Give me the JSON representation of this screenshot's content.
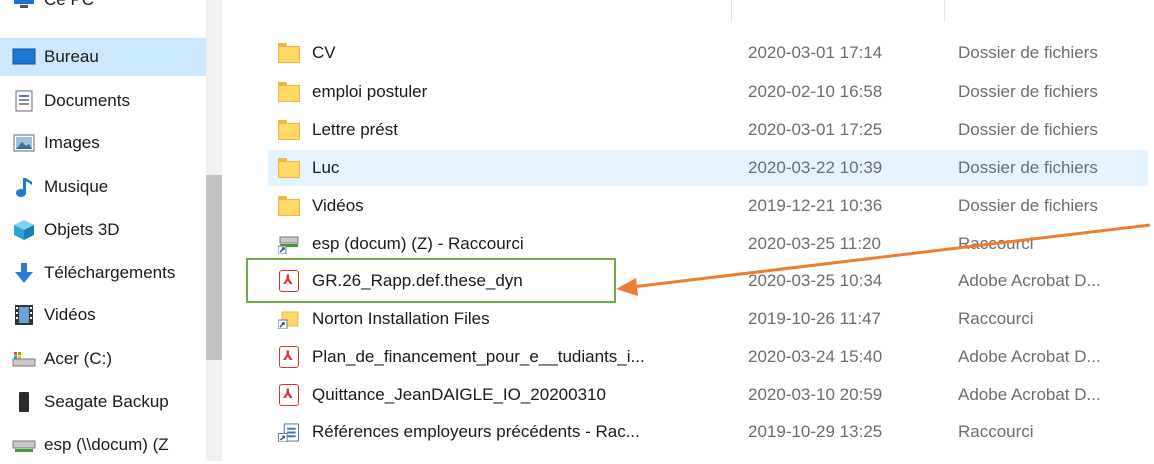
{
  "sidebar": {
    "items": [
      {
        "label": "Ce PC",
        "icon": "pc-icon"
      },
      {
        "label": "Bureau",
        "icon": "desktop-icon",
        "selected": true
      },
      {
        "label": "Documents",
        "icon": "documents-icon"
      },
      {
        "label": "Images",
        "icon": "images-icon"
      },
      {
        "label": "Musique",
        "icon": "music-icon"
      },
      {
        "label": "Objets 3D",
        "icon": "3d-objects-icon"
      },
      {
        "label": "Téléchargements",
        "icon": "download-icon"
      },
      {
        "label": "Vidéos",
        "icon": "videos-icon"
      },
      {
        "label": "Acer (C:)",
        "icon": "drive-icon"
      },
      {
        "label": "Seagate Backup",
        "icon": "external-drive-icon"
      },
      {
        "label": "esp (\\\\docum) (Z",
        "icon": "network-drive-icon"
      }
    ]
  },
  "files": [
    {
      "name": "CV",
      "date": "2020-03-01 17:14",
      "type": "Dossier de fichiers",
      "icon": "folder-icon"
    },
    {
      "name": "emploi postuler",
      "date": "2020-02-10 16:58",
      "type": "Dossier de fichiers",
      "icon": "folder-icon"
    },
    {
      "name": "Lettre prést",
      "date": "2020-03-01 17:25",
      "type": "Dossier de fichiers",
      "icon": "folder-icon"
    },
    {
      "name": "Luc",
      "date": "2020-03-22 10:39",
      "type": "Dossier de fichiers",
      "icon": "folder-icon",
      "hover": true
    },
    {
      "name": "Vidéos",
      "date": "2019-12-21 10:36",
      "type": "Dossier de fichiers",
      "icon": "folder-icon"
    },
    {
      "name": "esp (docum) (Z) - Raccourci",
      "date": "2020-03-25 11:20",
      "type": "Raccourci",
      "icon": "network-shortcut-icon"
    },
    {
      "name": "GR.26_Rapp.def.these_dyn",
      "date": "2020-03-25 10:34",
      "type": "Adobe Acrobat D...",
      "icon": "pdf-icon",
      "highlighted": true
    },
    {
      "name": "Norton Installation Files",
      "date": "2019-10-26 11:47",
      "type": "Raccourci",
      "icon": "shortcut-icon"
    },
    {
      "name": "Plan_de_financement_pour_e__tudiants_i...",
      "date": "2020-03-24 15:40",
      "type": "Adobe Acrobat D...",
      "icon": "pdf-icon"
    },
    {
      "name": "Quittance_JeanDAIGLE_IO_20200310",
      "date": "2020-03-10 20:59",
      "type": "Adobe Acrobat D...",
      "icon": "pdf-icon"
    },
    {
      "name": "Références employeurs précédents - Rac...",
      "date": "2019-10-29 13:25",
      "type": "Raccourci",
      "icon": "doc-shortcut-icon"
    }
  ],
  "annotation": {
    "arrow_color": "#ed7d31",
    "box_color": "#70ad47"
  }
}
